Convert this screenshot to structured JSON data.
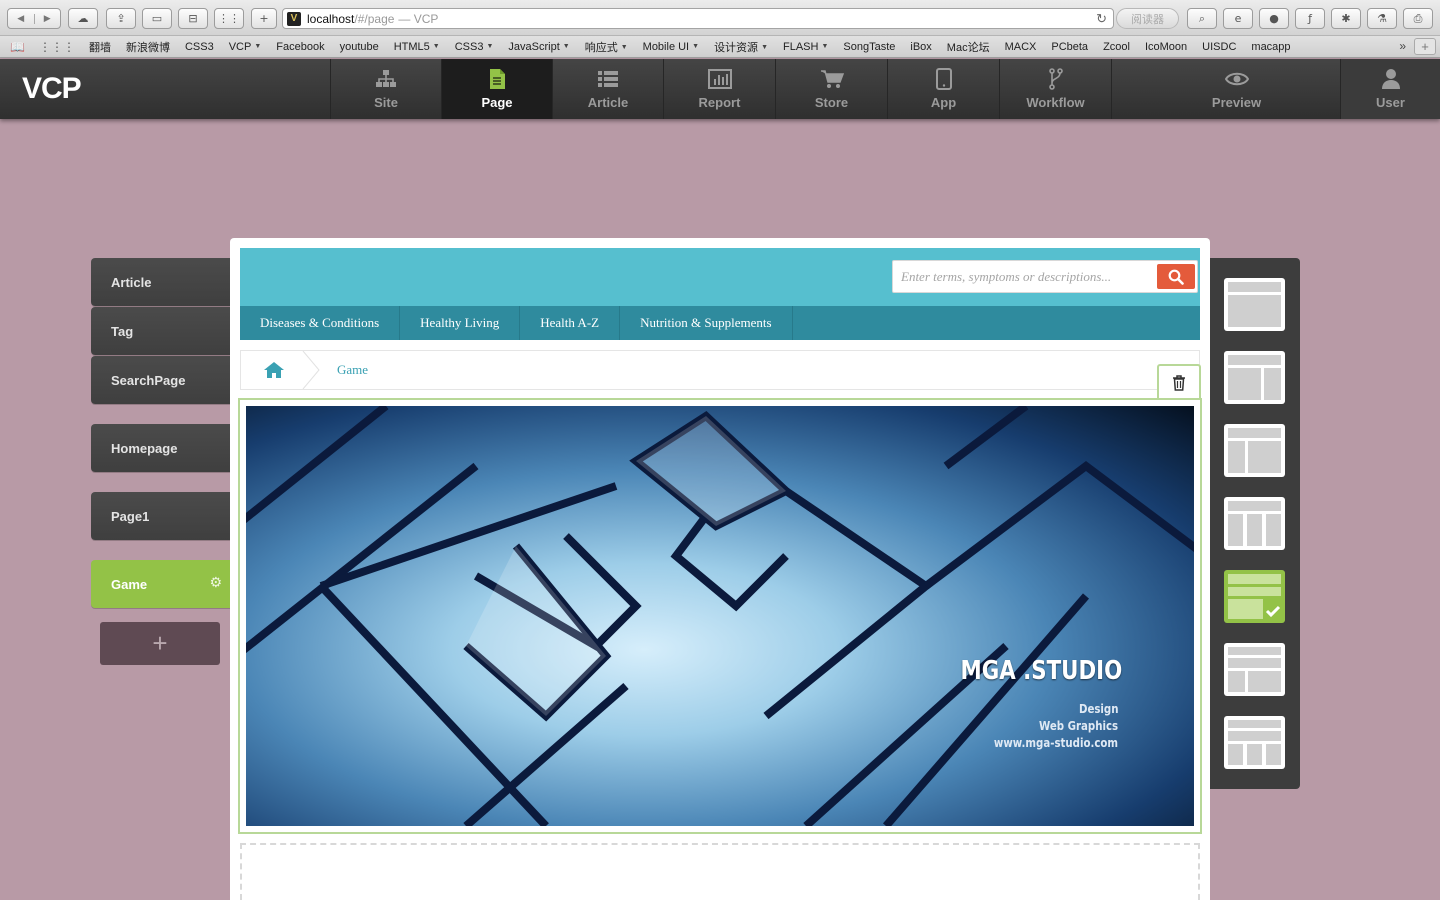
{
  "browser": {
    "url_host": "localhost",
    "url_path": "/#/page",
    "page_title": "— VCP",
    "reader_label": "阅读器"
  },
  "bookmarks": [
    {
      "label": "翻墙",
      "dropdown": false
    },
    {
      "label": "新浪微博",
      "dropdown": false
    },
    {
      "label": "CSS3",
      "dropdown": false
    },
    {
      "label": "VCP",
      "dropdown": true
    },
    {
      "label": "Facebook",
      "dropdown": false
    },
    {
      "label": "youtube",
      "dropdown": false
    },
    {
      "label": "HTML5",
      "dropdown": true
    },
    {
      "label": "CSS3",
      "dropdown": true
    },
    {
      "label": "JavaScript",
      "dropdown": true
    },
    {
      "label": "响应式",
      "dropdown": true
    },
    {
      "label": "Mobile UI",
      "dropdown": true
    },
    {
      "label": "设计资源",
      "dropdown": true
    },
    {
      "label": "FLASH",
      "dropdown": true
    },
    {
      "label": "SongTaste",
      "dropdown": false
    },
    {
      "label": "iBox",
      "dropdown": false
    },
    {
      "label": "Mac论坛",
      "dropdown": false
    },
    {
      "label": "MACX",
      "dropdown": false
    },
    {
      "label": "PCbeta",
      "dropdown": false
    },
    {
      "label": "Zcool",
      "dropdown": false
    },
    {
      "label": "IcoMoon",
      "dropdown": false
    },
    {
      "label": "UISDC",
      "dropdown": false
    },
    {
      "label": "macapp",
      "dropdown": false
    }
  ],
  "app": {
    "logo": "VCP",
    "nav": {
      "site": "Site",
      "page": "Page",
      "article": "Article",
      "report": "Report",
      "store": "Store",
      "app": "App",
      "workflow": "Workflow",
      "preview": "Preview",
      "user": "User"
    },
    "active_nav": "Page",
    "accent": "#93c247"
  },
  "sidebar": {
    "article": "Article",
    "tag": "Tag",
    "search_page": "SearchPage",
    "homepage": "Homepage",
    "page1": "Page1",
    "game": "Game",
    "add": "+"
  },
  "site": {
    "search_placeholder": "Enter terms, symptoms or descriptions...",
    "nav": {
      "diseases": "Diseases & Conditions",
      "healthy": "Healthy Living",
      "az": "Health A-Z",
      "nutrition": "Nutrition & Supplements"
    },
    "breadcrumb": "Game",
    "header_color": "#56bfcf",
    "nav_color": "#2f8b9e",
    "search_button_color": "#e45b3b"
  },
  "banner": {
    "title": "MGA .STUDIO",
    "line1": "Design",
    "line2": "Web Graphics",
    "line3": "www.mga-studio.com"
  },
  "layouts": {
    "count": 7,
    "selected": 5
  }
}
